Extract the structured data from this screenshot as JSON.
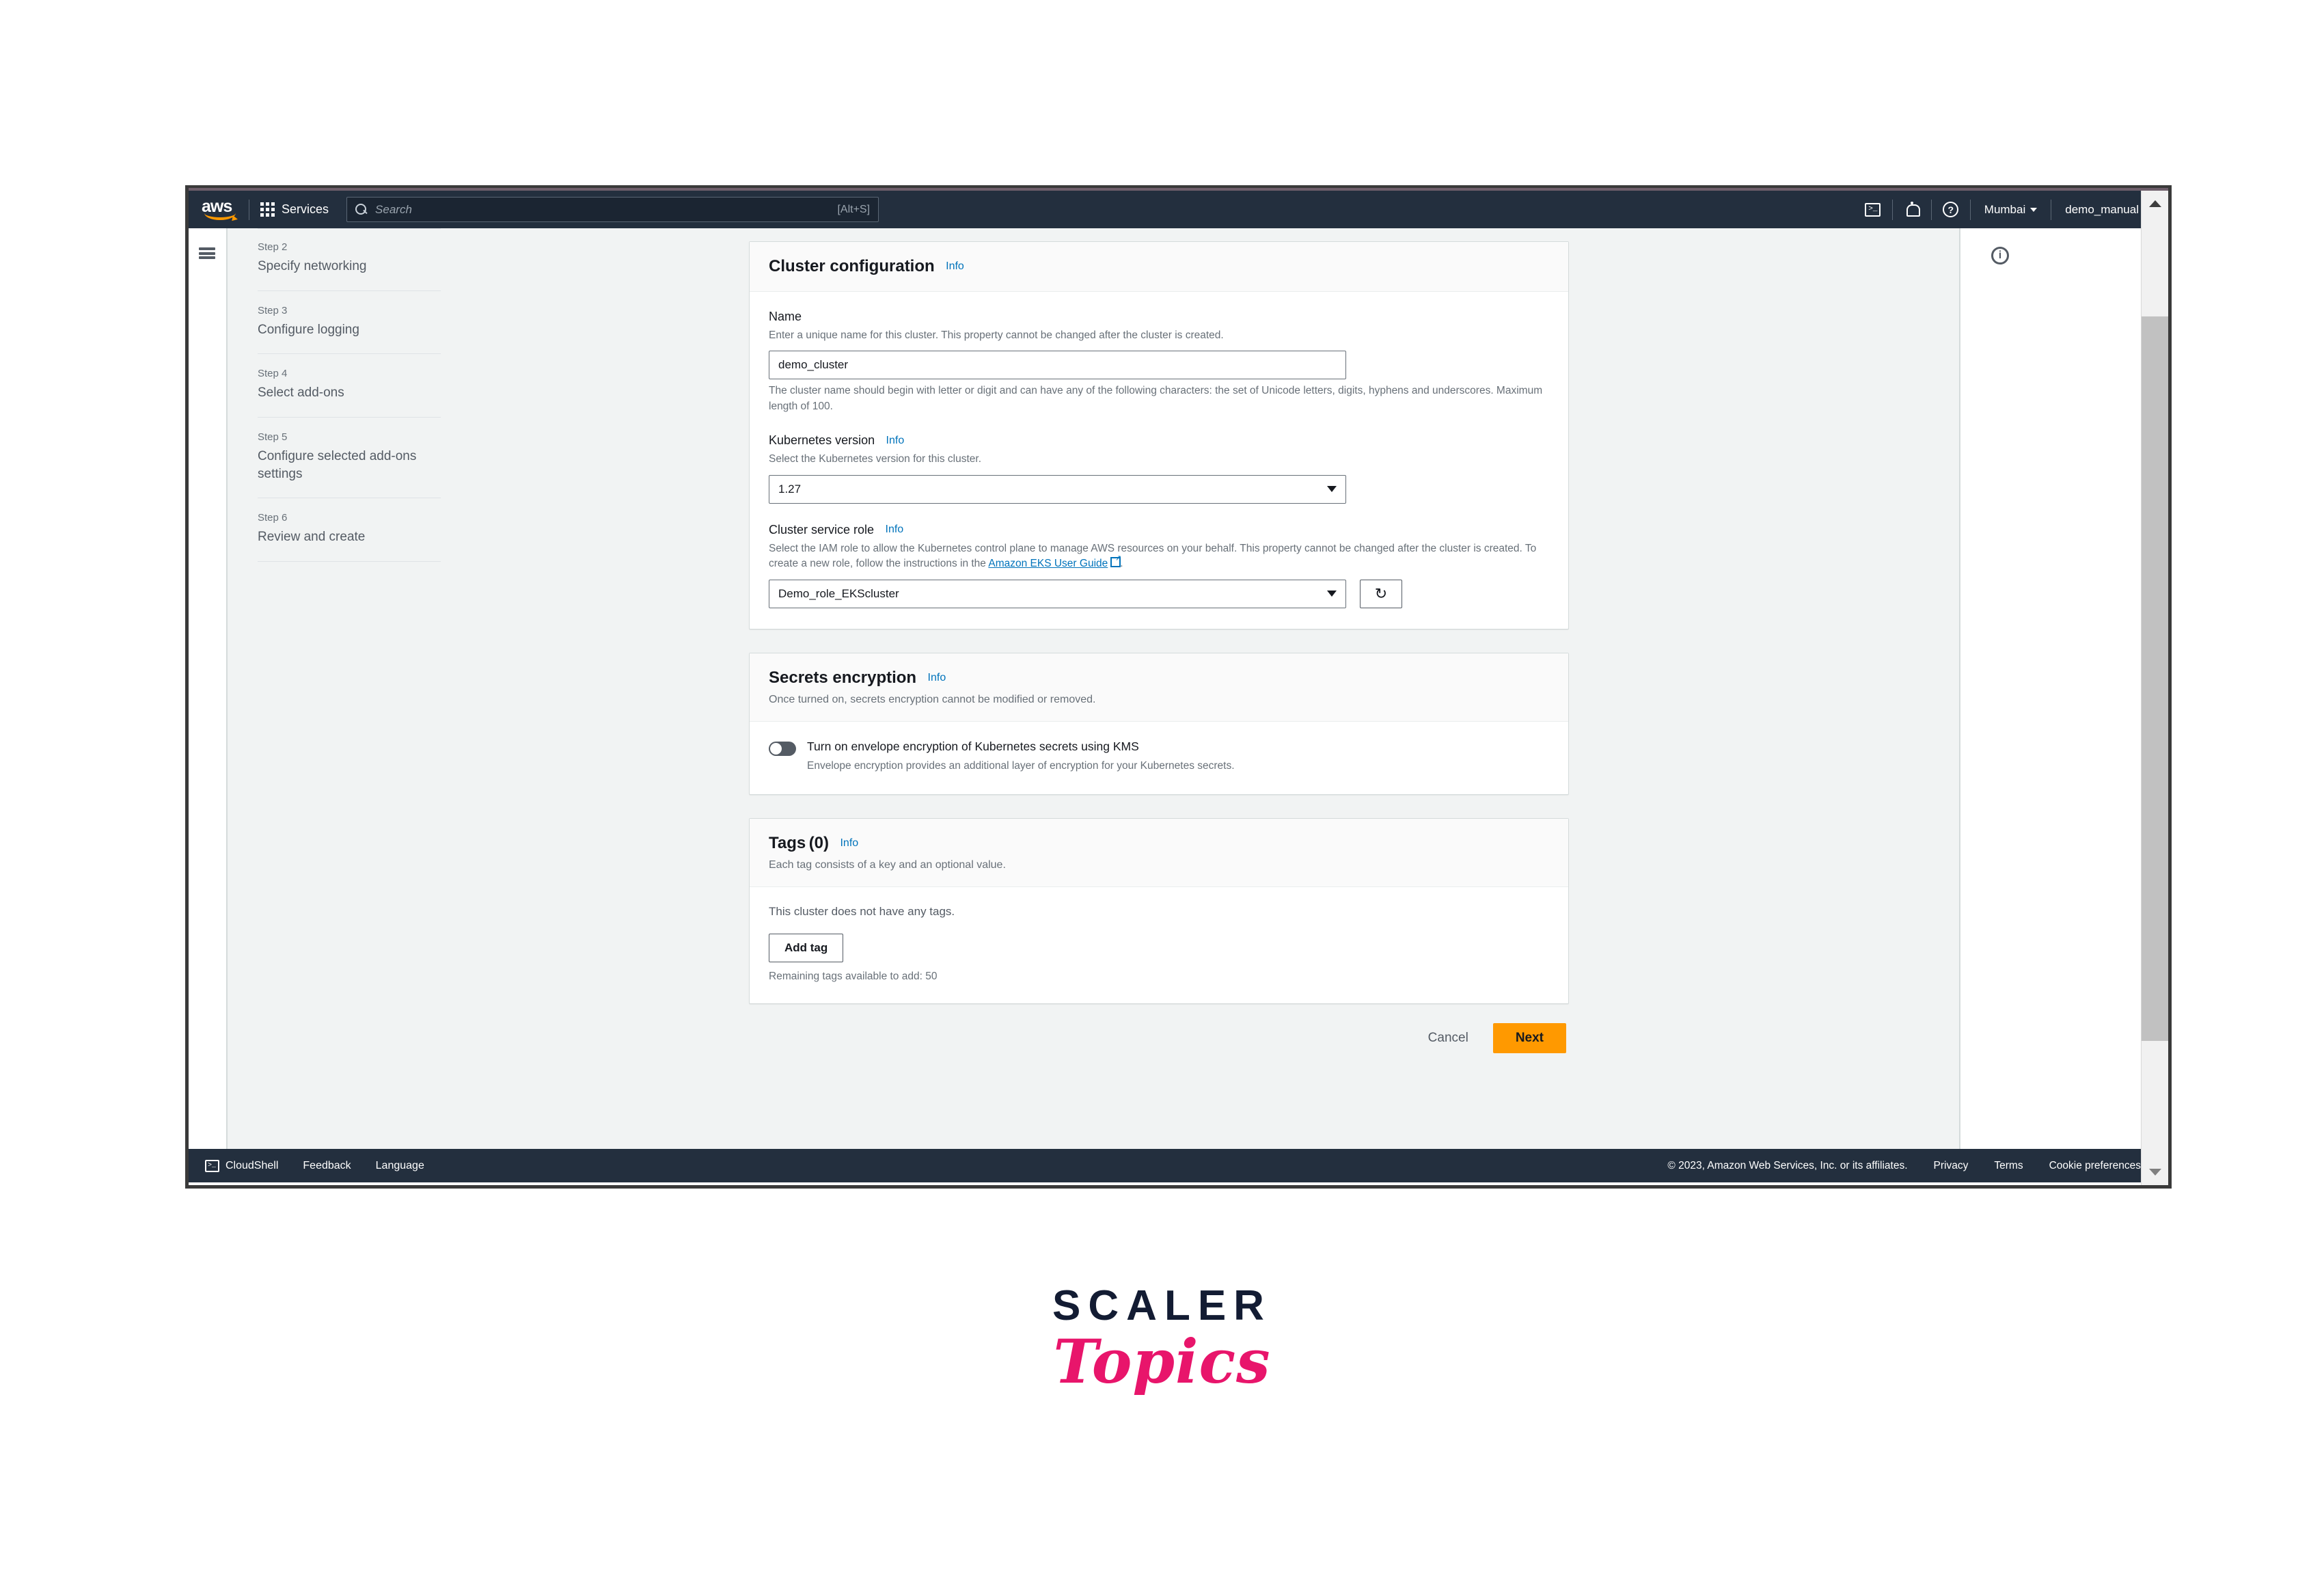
{
  "topnav": {
    "logo_alt": "aws",
    "services_label": "Services",
    "search_placeholder": "Search",
    "search_shortcut": "[Alt+S]",
    "cloudshell_icon": "cloudshell-icon",
    "notifications_icon": "bell-icon",
    "help_icon": "question-mark-icon",
    "region": "Mumbai",
    "account": "demo_manual",
    "bg_color": "#232f3e"
  },
  "sidebar": {
    "steps": [
      {
        "kicker": "Step 2",
        "title": "Specify networking"
      },
      {
        "kicker": "Step 3",
        "title": "Configure logging"
      },
      {
        "kicker": "Step 4",
        "title": "Select add-ons"
      },
      {
        "kicker": "Step 5",
        "title": "Configure selected add-ons settings"
      },
      {
        "kicker": "Step 6",
        "title": "Review and create"
      }
    ]
  },
  "cluster_config": {
    "title": "Cluster configuration",
    "info_label": "Info",
    "name": {
      "label": "Name",
      "hint": "Enter a unique name for this cluster. This property cannot be changed after the cluster is created.",
      "value": "demo_cluster",
      "constraint": "The cluster name should begin with letter or digit and can have any of the following characters: the set of Unicode letters, digits, hyphens and underscores. Maximum length of 100."
    },
    "kubernetes_version": {
      "label": "Kubernetes version",
      "info_label": "Info",
      "hint": "Select the Kubernetes version for this cluster.",
      "value": "1.27"
    },
    "service_role": {
      "label": "Cluster service role",
      "info_label": "Info",
      "hint_part1": "Select the IAM role to allow the Kubernetes control plane to manage AWS resources on your behalf. This property cannot be changed after the cluster is created. To create a new role, follow the instructions in the ",
      "hint_link": "Amazon EKS User Guide",
      "hint_part2": ".",
      "value": "Demo_role_EKScluster",
      "refresh_icon": "refresh-icon"
    }
  },
  "secrets_encryption": {
    "title": "Secrets encryption",
    "info_label": "Info",
    "description": "Once turned on, secrets encryption cannot be modified or removed.",
    "toggle_label": "Turn on envelope encryption of Kubernetes secrets using KMS",
    "toggle_sub": "Envelope encryption provides an additional layer of encryption for your Kubernetes secrets.",
    "toggle_state": "off"
  },
  "tags": {
    "title": "Tags",
    "count": "(0)",
    "info_label": "Info",
    "description": "Each tag consists of a key and an optional value.",
    "empty_message": "This cluster does not have any tags.",
    "add_button": "Add tag",
    "remaining": "Remaining tags available to add: 50"
  },
  "actions": {
    "cancel": "Cancel",
    "next": "Next",
    "next_color": "#ff9900"
  },
  "helper_panel": {
    "info_icon": "info-circle-icon"
  },
  "footer": {
    "cloudshell": "CloudShell",
    "feedback": "Feedback",
    "language": "Language",
    "copyright": "© 2023, Amazon Web Services, Inc. or its affiliates.",
    "privacy": "Privacy",
    "terms": "Terms",
    "cookie_preferences": "Cookie preferences"
  },
  "watermark": {
    "line1": "SCALER",
    "line2": "Topics",
    "line1_color": "#131c33",
    "line2_color": "#e8156b"
  }
}
